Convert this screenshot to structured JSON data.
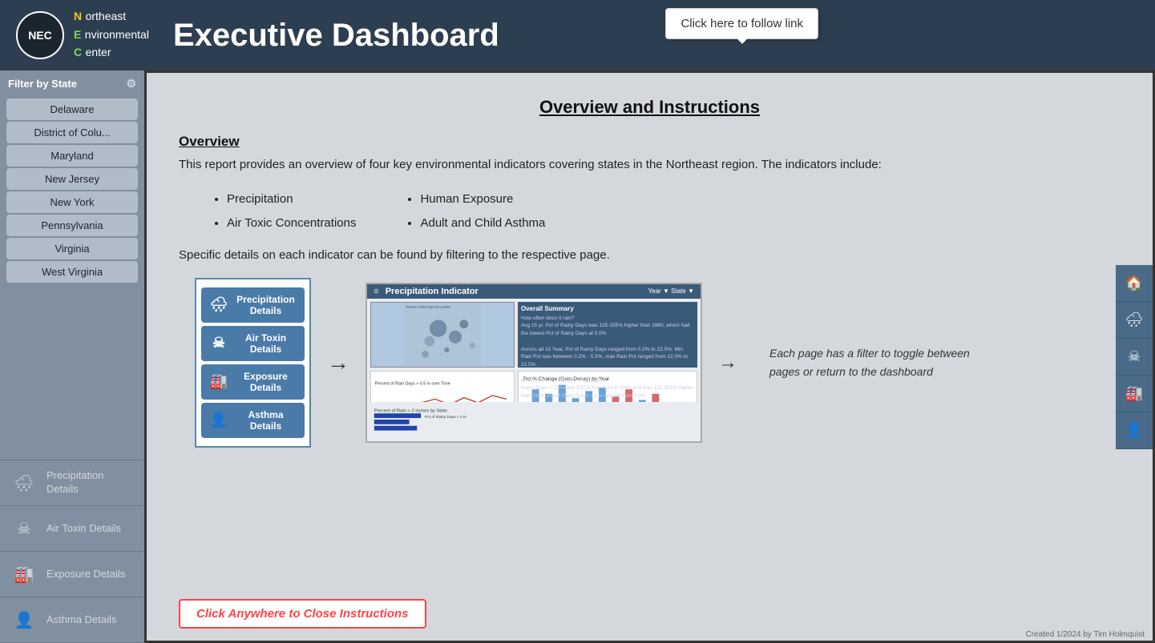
{
  "header": {
    "logo_text": "NEC",
    "org_line1_n": "N",
    "org_line1_text": "ortheast",
    "org_line2_e": "E",
    "org_line2_text": "nvironmental",
    "org_line3_c": "C",
    "org_line3_text": "enter",
    "title": "Executive Dashboard",
    "tooltip": "Click here to follow link"
  },
  "sidebar": {
    "filter_label": "Filter by State",
    "states": [
      "Delaware",
      "District of Colu...",
      "Maryland",
      "New Jersey",
      "New York",
      "Pennsylvania",
      "Virginia",
      "West Virginia"
    ],
    "nav_items": [
      {
        "label": "Precipitation Details",
        "icon": "🌧"
      },
      {
        "label": "Air Toxin Details",
        "icon": "☠"
      },
      {
        "label": "Exposure Details",
        "icon": "🏭"
      },
      {
        "label": "Asthma Details",
        "icon": "👤"
      }
    ]
  },
  "instructions": {
    "title": "Overview and Instructions",
    "overview_heading": "Overview",
    "overview_text": "This report provides an overview of four key environmental indicators covering states in the Northeast region.  The indicators include:",
    "bullets_left": [
      "Precipitation",
      "Air Toxic Concentrations"
    ],
    "bullets_right": [
      "Human Exposure",
      "Adult and Child Asthma"
    ],
    "specific_text": "Specific details on each indicator can be found by filtering to the respective page.",
    "page_buttons": [
      {
        "label": "Precipitation Details",
        "icon": "🌧"
      },
      {
        "label": "Air Toxin Details",
        "icon": "☠"
      },
      {
        "label": "Exposure Details",
        "icon": "🏭"
      },
      {
        "label": "Asthma Details",
        "icon": "👤"
      }
    ],
    "page_desc": "Each page has a filter to toggle between pages or return to the dashboard",
    "close_btn": "Click Anywhere to Close Instructions"
  },
  "right_nav": [
    {
      "icon": "🏠",
      "label": "home-icon"
    },
    {
      "icon": "🌧",
      "label": "precipitation-icon"
    },
    {
      "icon": "☠",
      "label": "airtoxin-icon"
    },
    {
      "icon": "🏭",
      "label": "exposure-icon"
    },
    {
      "icon": "👤",
      "label": "asthma-icon"
    }
  ],
  "footer": {
    "text": "Created 1/2024 by Tim Holmquist"
  }
}
